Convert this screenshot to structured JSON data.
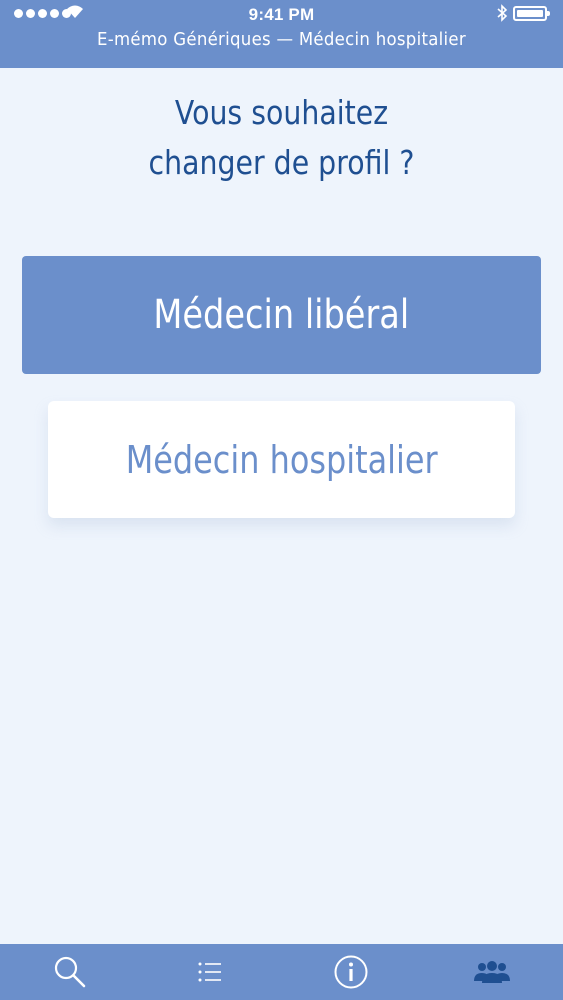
{
  "status_bar": {
    "time": "9:41 PM",
    "icons": [
      "signal-dots",
      "wifi-icon",
      "bluetooth-icon",
      "battery-icon"
    ]
  },
  "header": {
    "title": "E-mémo Génériques — Médecin hospitalier"
  },
  "main": {
    "question_line1": "Vous souhaitez",
    "question_line2": "changer de profil ?",
    "option_liberal": "Médecin libéral",
    "option_hospitalier": "Médecin hospitalier"
  },
  "tab_bar": {
    "tabs": [
      {
        "icon": "search-icon",
        "active": false
      },
      {
        "icon": "list-icon",
        "active": false
      },
      {
        "icon": "info-icon",
        "active": false
      },
      {
        "icon": "users-icon",
        "active": true
      }
    ]
  },
  "colors": {
    "primary": "#6b8fcb",
    "background": "#eef4fc",
    "heading": "#1f4f91",
    "active_tab_icon": "#1f4f91",
    "tab_icon": "#ffffff"
  }
}
